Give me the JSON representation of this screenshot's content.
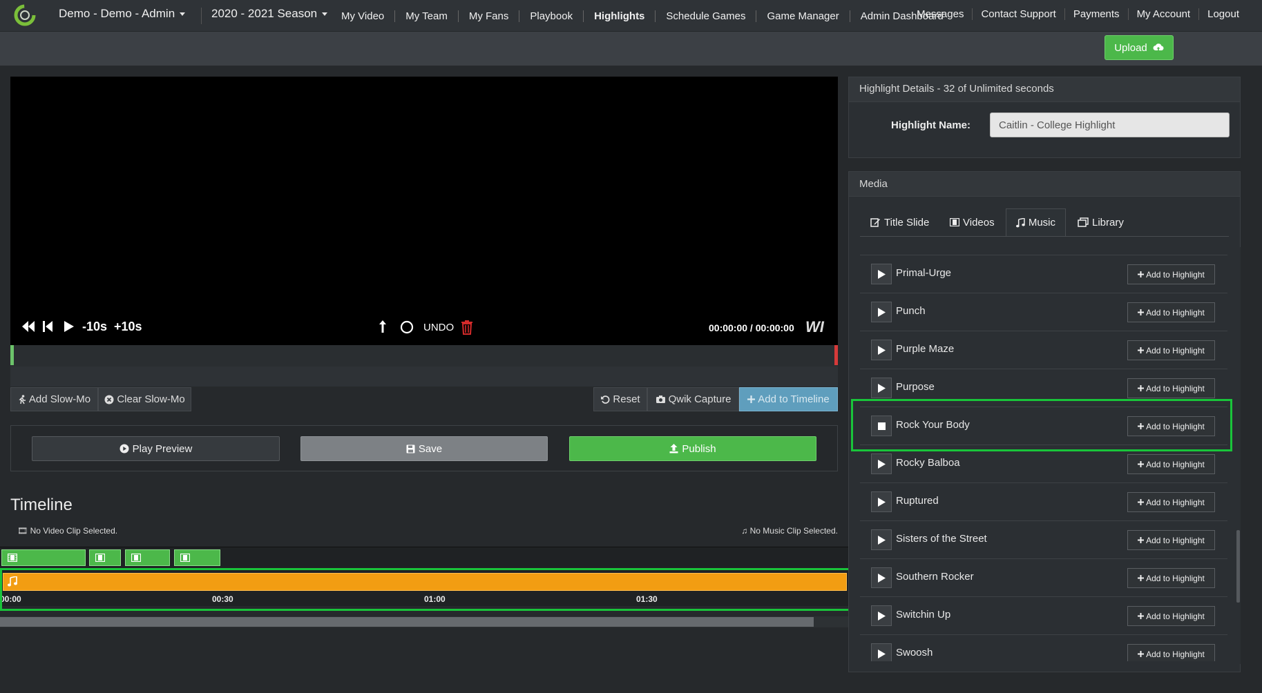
{
  "header": {
    "account": "Demo - Demo - Admin",
    "season": "2020 - 2021 Season",
    "links": [
      "Messages",
      "Contact Support",
      "Payments",
      "My Account",
      "Logout"
    ]
  },
  "nav": {
    "items": [
      "My Video",
      "My Team",
      "My Fans",
      "Playbook",
      "Highlights",
      "Schedule Games",
      "Game Manager",
      "Admin Dashboard"
    ],
    "active": "Highlights",
    "upload_label": "Upload"
  },
  "player": {
    "minus10": "-10s",
    "plus10": "+10s",
    "undo": "UNDO",
    "time": "00:00:00 / 00:00:00",
    "watermark": "WI"
  },
  "tools": {
    "add_slowmo": "Add Slow-Mo",
    "clear_slowmo": "Clear Slow-Mo",
    "reset": "Reset",
    "qwik_capture": "Qwik Capture",
    "add_to_timeline": "Add to Timeline"
  },
  "actions": {
    "play_preview": "Play Preview",
    "save": "Save",
    "publish": "Publish"
  },
  "timeline": {
    "title": "Timeline",
    "video_status": "No Video Clip Selected.",
    "music_status": "No Music Clip Selected.",
    "ticks": [
      "00:00",
      "00:30",
      "01:00",
      "01:30"
    ]
  },
  "details": {
    "title": "Highlight Details - 32 of Unlimited seconds",
    "name_label": "Highlight Name:",
    "name_value": "Caitlin - College Highlight"
  },
  "media": {
    "title": "Media",
    "tabs": [
      "Title Slide",
      "Videos",
      "Music",
      "Library"
    ],
    "active_tab": "Music",
    "add_label": "Add to Highlight",
    "tracks": [
      {
        "name": "Primal-Urge",
        "playing": false
      },
      {
        "name": "Punch",
        "playing": false
      },
      {
        "name": "Purple Maze",
        "playing": false
      },
      {
        "name": "Purpose",
        "playing": false
      },
      {
        "name": "Rock Your Body",
        "playing": true
      },
      {
        "name": "Rocky Balboa",
        "playing": false
      },
      {
        "name": "Ruptured",
        "playing": false
      },
      {
        "name": "Sisters of the Street",
        "playing": false
      },
      {
        "name": "Southern Rocker",
        "playing": false
      },
      {
        "name": "Switchin Up",
        "playing": false
      },
      {
        "name": "Swoosh",
        "playing": false
      }
    ]
  },
  "colors": {
    "accent_green": "#4cb84a",
    "music_orange": "#f29d12",
    "highlight_box": "#19c43a",
    "timeline_btn_blue": "#5f9ebd",
    "trash_red": "#d42a2a"
  }
}
